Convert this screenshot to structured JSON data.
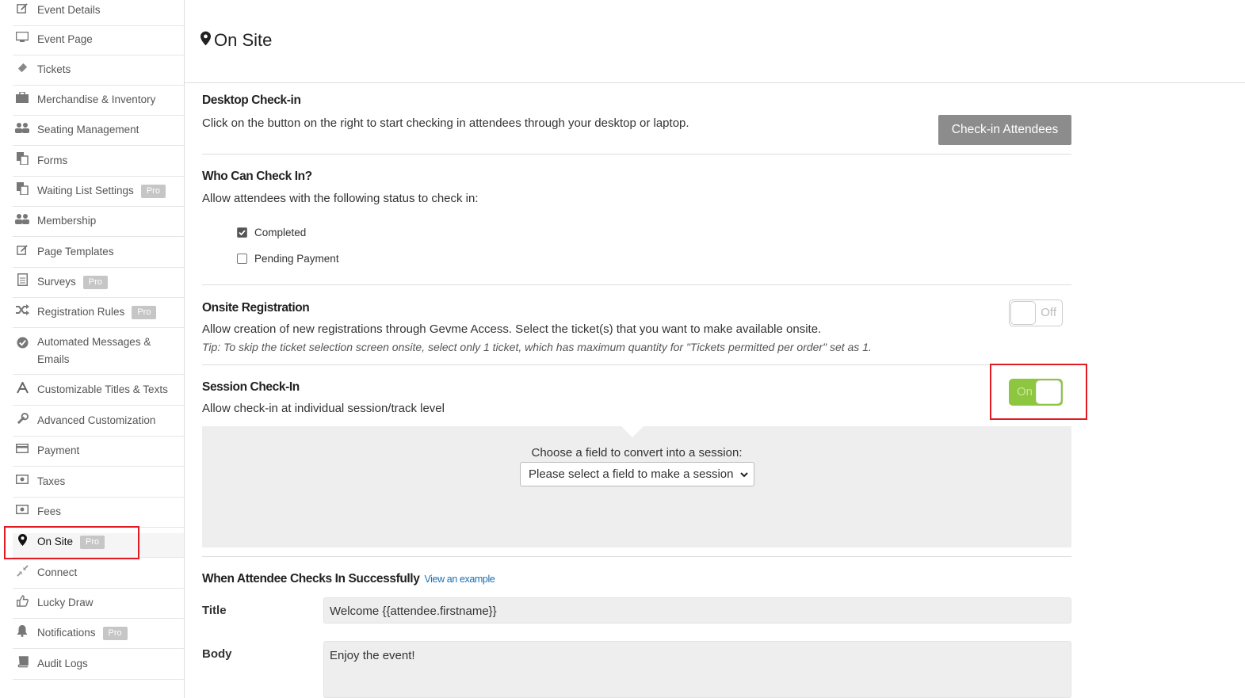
{
  "sidebar": {
    "items": [
      {
        "label": "Event Details",
        "icon": "edit-icon"
      },
      {
        "label": "Event Page",
        "icon": "monitor-icon"
      },
      {
        "label": "Tickets",
        "icon": "ticket-icon"
      },
      {
        "label": "Merchandise & Inventory",
        "icon": "briefcase-icon"
      },
      {
        "label": "Seating Management",
        "icon": "users-icon"
      },
      {
        "label": "Forms",
        "icon": "copy-icon"
      },
      {
        "label": "Waiting List Settings",
        "icon": "copy-icon",
        "badge": "Pro"
      },
      {
        "label": "Membership",
        "icon": "users-icon"
      },
      {
        "label": "Page Templates",
        "icon": "edit-icon"
      },
      {
        "label": "Surveys",
        "icon": "document-icon",
        "badge": "Pro"
      },
      {
        "label": "Registration Rules",
        "icon": "shuffle-icon",
        "badge": "Pro"
      },
      {
        "label": "Automated Messages & Emails",
        "icon": "check-circle-icon"
      },
      {
        "label": "Customizable Titles & Texts",
        "icon": "font-icon"
      },
      {
        "label": "Advanced Customization",
        "icon": "wrench-icon"
      },
      {
        "label": "Payment",
        "icon": "credit-card-icon"
      },
      {
        "label": "Taxes",
        "icon": "money-icon"
      },
      {
        "label": "Fees",
        "icon": "money-icon"
      },
      {
        "label": "On Site",
        "icon": "map-pin-icon",
        "badge": "Pro",
        "active": true
      },
      {
        "label": "Connect",
        "icon": "compress-icon"
      },
      {
        "label": "Lucky Draw",
        "icon": "thumbs-up-icon"
      },
      {
        "label": "Notifications",
        "icon": "bell-icon",
        "badge": "Pro"
      },
      {
        "label": "Audit Logs",
        "icon": "book-icon"
      }
    ]
  },
  "main": {
    "title": "On Site",
    "desktop_checkin": {
      "title": "Desktop Check-in",
      "text": "Click on the button on the right to start checking in attendees through your desktop or laptop.",
      "button": "Check-in Attendees"
    },
    "who_can_check_in": {
      "title": "Who Can Check In?",
      "text": "Allow attendees with the following status to check in:",
      "options": [
        {
          "label": "Completed",
          "checked": true
        },
        {
          "label": "Pending Payment",
          "checked": false
        }
      ]
    },
    "onsite_registration": {
      "title": "Onsite Registration",
      "text": "Allow creation of new registrations through Gevme Access. Select the ticket(s) that you want to make available onsite.",
      "tip": "Tip: To skip the ticket selection screen onsite, select only 1 ticket, which has maximum quantity for \"Tickets permitted per order\" set as 1.",
      "toggle_label": "Off"
    },
    "session_checkin": {
      "title": "Session Check-In",
      "text": "Allow check-in at individual session/track level",
      "toggle_label": "On",
      "choose_label": "Choose a field to convert into a session:",
      "select_value": "Please select a field to make a session"
    },
    "success": {
      "title": "When Attendee Checks In Successfully",
      "link": "View an example",
      "title_label": "Title",
      "title_value": "Welcome {{attendee.firstname}}",
      "body_label": "Body",
      "body_value": "Enjoy the event!"
    }
  },
  "colors": {
    "toggle_on": "#8dc63f",
    "highlight": "#e01b24",
    "link": "#1a6fb3",
    "button_gray": "#8c8c8c"
  }
}
